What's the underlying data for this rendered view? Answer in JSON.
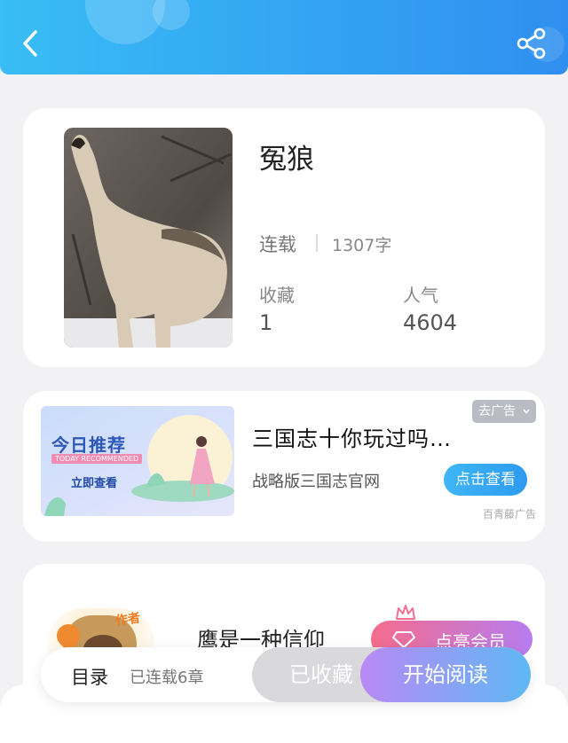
{
  "header": {
    "back_icon": "chevron-left-icon",
    "share_icon": "share-icon",
    "gradient": [
      "#38bdf5",
      "#2f8ff0"
    ]
  },
  "book": {
    "title": "冤狼",
    "status": "连载",
    "word_count": "1307字",
    "favorites_label": "收藏",
    "favorites_value": "1",
    "popularity_label": "人气",
    "popularity_value": "4604"
  },
  "ad": {
    "banner_title": "今日推荐",
    "banner_en": "TODAY RECOMMENDED",
    "banner_cta": "立即查看",
    "title": "三国志十你玩过吗…",
    "subtitle": "战略版三国志官网",
    "cta": "点击查看",
    "close_label": "去广告",
    "source": "百青藤广告"
  },
  "author": {
    "badge": "作者",
    "name": "鹰是一种信仰",
    "vip_label": "点亮会员"
  },
  "bottom_bar": {
    "toc_label": "目录",
    "toc_sub": "已连载6章",
    "favorite_label": "已收藏",
    "read_label": "开始阅读"
  },
  "colors": {
    "accent": "#2f9bf0",
    "vip": "#f06a8a",
    "read_start": "#b98af4",
    "read_end": "#5fb8f3"
  }
}
